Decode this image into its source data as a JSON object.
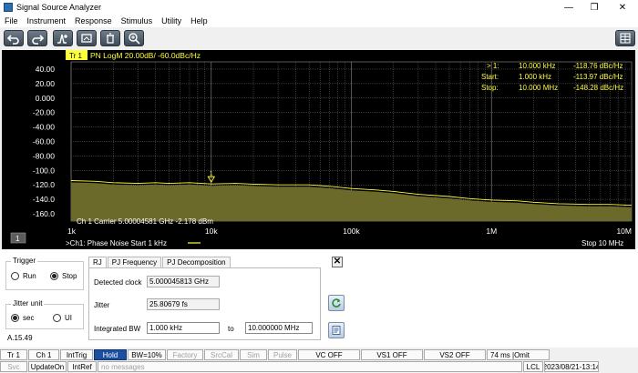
{
  "window": {
    "title": "Signal Source Analyzer"
  },
  "menu": [
    "File",
    "Instrument",
    "Response",
    "Stimulus",
    "Utility",
    "Help"
  ],
  "toolbar": {
    "icons": [
      "undo-icon",
      "redo-icon",
      "marker-add-icon",
      "snapshot-icon",
      "delete-icon",
      "zoom-icon",
      "grid-menu-icon"
    ]
  },
  "plot": {
    "trace_tab": "Tr 1",
    "trace_header": "PN LogM 20.00dB/ -60.0dBc/Hz",
    "y_ticks": [
      "40.00",
      "20.00",
      "0.000",
      "-20.00",
      "-40.00",
      "-60.00",
      "-80.00",
      "-100.0",
      "-120.0",
      "-140.0",
      "-160.0"
    ],
    "x_ticks": [
      "1k",
      "10k",
      "100k",
      "1M",
      "10M"
    ],
    "channel_num": "1",
    "markers": [
      {
        "label": "> 1:",
        "freq": "10.000  kHz",
        "value": "-118.76 dBc/Hz"
      },
      {
        "label": "Start:",
        "freq": "1.000  kHz",
        "value": "-113.97 dBc/Hz"
      },
      {
        "label": "Stop:",
        "freq": "10.000  MHz",
        "value": "-148.28 dBc/Hz"
      }
    ],
    "marker_tag": "1",
    "carrier_text": "Ch 1  Carrier 5.00004581 GHz    -2.178 dBm",
    "footer_left": ">Ch1: Phase Noise  Start  1 kHz",
    "footer_right": "Stop  10 MHz",
    "colors": {
      "trace": "#ffff3c",
      "fill": "#6b6a2a",
      "grid": "#6d6d6d",
      "text": "#ffffff",
      "header": "#ffff3c"
    }
  },
  "chart_data": {
    "type": "line",
    "xscale": "log",
    "xlim": [
      1000,
      10000000
    ],
    "ylim": [
      -170,
      50
    ],
    "ylabel": "",
    "xlabel": "",
    "series": [
      {
        "x": [
          1000,
          1500,
          2000,
          3000,
          4000,
          5000,
          7000,
          10000,
          15000,
          20000,
          30000,
          50000,
          70000,
          100000,
          150000,
          200000,
          300000,
          500000,
          700000,
          1000000,
          1500000,
          2000000,
          3000000,
          5000000,
          7000000,
          10000000
        ],
        "values": [
          -114,
          -115,
          -117,
          -118,
          -117,
          -118,
          -117,
          -118.76,
          -118,
          -119,
          -120,
          -120,
          -122,
          -125,
          -127,
          -129,
          -133,
          -136,
          -139,
          -141,
          -142,
          -144,
          -146,
          -147,
          -147,
          -148.28
        ]
      }
    ]
  },
  "trigger": {
    "label": "Trigger",
    "run": "Run",
    "stop": "Stop",
    "selected": "Stop"
  },
  "jitter_unit": {
    "label": "Jitter unit",
    "sec": "sec",
    "ui": "UI",
    "selected": "sec"
  },
  "version": "A.15.49",
  "tabs": [
    "RJ",
    "PJ Frequency",
    "PJ Decomposition"
  ],
  "fields": {
    "detected_clock_label": "Detected clock",
    "detected_clock": "5.000045813 GHz",
    "jitter_label": "Jitter",
    "jitter": "25.80679 fs",
    "integrated_bw_label": "Integrated BW",
    "bw_start": "1.000 kHz",
    "to_label": "to",
    "bw_stop": "10.000000 MHz"
  },
  "close_label": "✕",
  "status1": [
    "Tr 1",
    "Ch 1",
    "IntTrig",
    "Hold",
    "BW=10%",
    "Factory",
    "SrcCal",
    "Sim",
    "Pulse",
    "VC OFF",
    "VS1 OFF",
    "VS2 OFF",
    "74 ms |Omit"
  ],
  "status2": [
    "Svc",
    "UpdateOn",
    "IntRef",
    "no messages",
    "LCL",
    "2023/08/21-13:14"
  ]
}
